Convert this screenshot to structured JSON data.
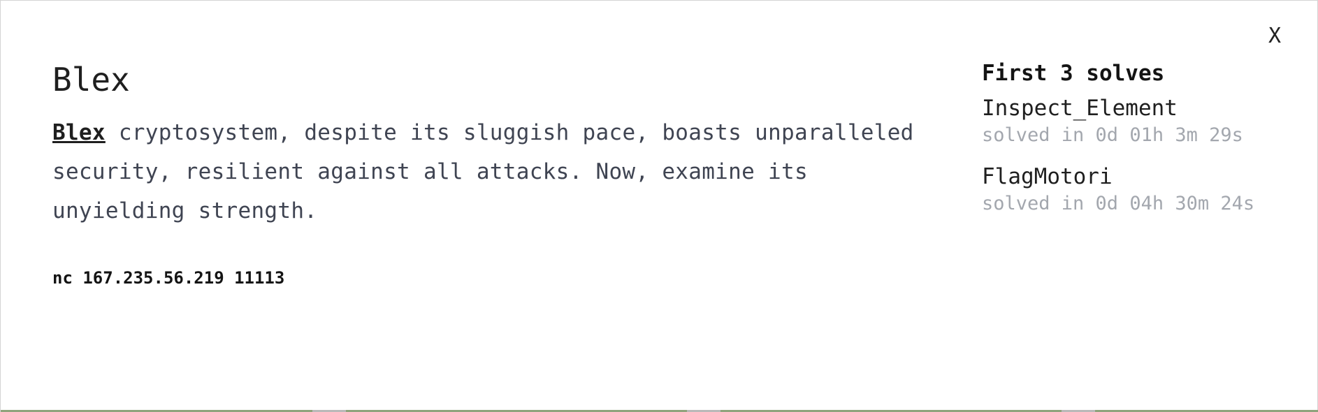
{
  "modal": {
    "close_label": "X"
  },
  "challenge": {
    "title": "Blex",
    "link_text": "Blex",
    "description": " cryptosystem, despite its sluggish pace, boasts unparalleled security, resilient against all attacks. Now, examine its unyielding strength.",
    "command": "nc 167.235.56.219 11113"
  },
  "solves": {
    "title": "First 3 solves",
    "items": [
      {
        "name": "Inspect_Element",
        "time": "solved in 0d 01h 3m 29s"
      },
      {
        "name": "FlagMotori",
        "time": "solved in 0d 04h 30m 24s"
      }
    ]
  },
  "colors": {
    "bottom_bar": "#8fa37c",
    "muted_text": "#a3a7ae"
  }
}
